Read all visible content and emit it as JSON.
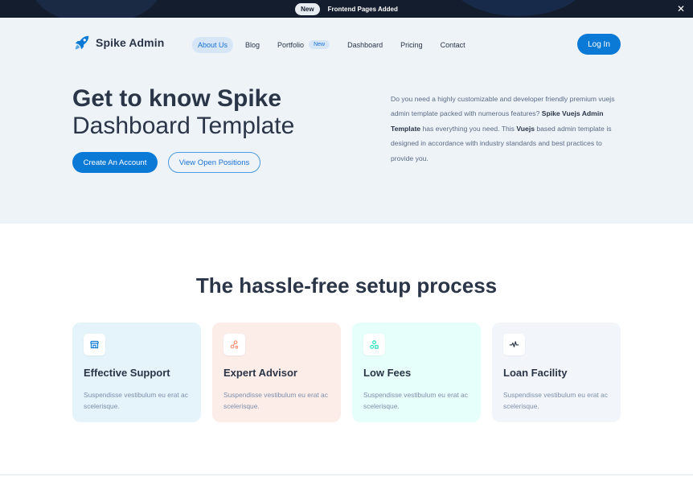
{
  "announcement": {
    "badge": "New",
    "message": "Frontend Pages Added",
    "close_glyph": "✕"
  },
  "brand": {
    "name": "Spike Admin",
    "icon": "rocket-icon",
    "color": "#0b7ad6"
  },
  "nav": {
    "items": [
      {
        "label": "About Us",
        "active": true
      },
      {
        "label": "Blog"
      },
      {
        "label": "Portfolio",
        "badge": "New"
      },
      {
        "label": "Dashboard"
      },
      {
        "label": "Pricing"
      },
      {
        "label": "Contact"
      }
    ],
    "login_label": "Log In"
  },
  "hero": {
    "title_line1": "Get to know Spike",
    "title_line2": "Dashboard Template",
    "primary_button": "Create An Account",
    "secondary_button": "View Open Positions",
    "description": {
      "part1": "Do you need a highly customizable and developer friendly premium vuejs admin template packed with numerous features? ",
      "bold1": "Spike Vuejs Admin Template",
      "part2": " has everything you need. This ",
      "bold2": "Vuejs",
      "part3": " based admin template is designed in accordance with industry standards and best practices to provide you."
    }
  },
  "setup": {
    "title": "The hassle-free setup process",
    "cards": [
      {
        "title": "Effective Support",
        "text": "Suspendisse vestibulum eu erat ac scelerisque.",
        "icon": "building-icon",
        "bg": "#e5f3fb",
        "icon_color": "#0b7ad6"
      },
      {
        "title": "Expert Advisor",
        "text": "Suspendisse vestibulum eu erat ac scelerisque.",
        "icon": "nodes-icon",
        "bg": "#fdede8",
        "icon_color": "#fa896b"
      },
      {
        "title": "Low Fees",
        "text": "Suspendisse vestibulum eu erat ac scelerisque.",
        "icon": "shapes-icon",
        "bg": "#e6fffa",
        "icon_color": "#13deb9"
      },
      {
        "title": "Loan Facility",
        "text": "Suspendisse vestibulum eu erat ac scelerisque.",
        "icon": "activity-icon",
        "bg": "#f2f6fa",
        "icon_color": "#2a3547"
      }
    ]
  }
}
